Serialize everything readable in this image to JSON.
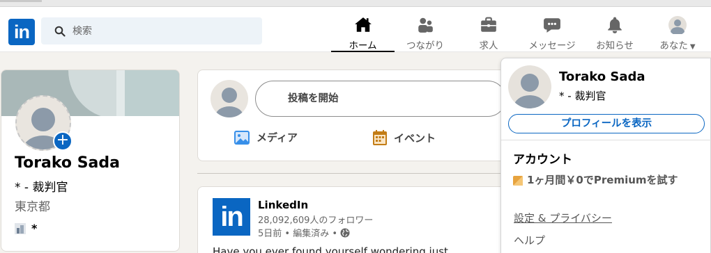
{
  "header": {
    "logo_text": "in",
    "search_placeholder": "検索",
    "nav": [
      {
        "label": "ホーム",
        "icon": "home-icon",
        "active": true
      },
      {
        "label": "つながり",
        "icon": "people-icon"
      },
      {
        "label": "求人",
        "icon": "briefcase-icon"
      },
      {
        "label": "メッセージ",
        "icon": "message-icon"
      },
      {
        "label": "お知らせ",
        "icon": "bell-icon"
      },
      {
        "label": "あなた",
        "icon": "me-avatar-icon"
      }
    ]
  },
  "profile": {
    "name": "Torako Sada",
    "title": "* - 裁判官",
    "location": "東京都",
    "company": "*"
  },
  "composer": {
    "placeholder": "投稿を開始",
    "actions": [
      {
        "label": "メディア",
        "icon": "image-icon"
      },
      {
        "label": "イベント",
        "icon": "calendar-icon"
      }
    ]
  },
  "feed": {
    "author": "LinkedIn",
    "logo_text": "in",
    "followers": "28,092,609人のフォロワー",
    "meta": "5日前 • 編集済み •",
    "text_partial": "Have you ever found yourself wondering just"
  },
  "dropdown": {
    "name": "Torako Sada",
    "title": "* - 裁判官",
    "view_profile": "プロフィールを表示",
    "section": "アカウント",
    "premium": "1ヶ月間￥0でPremiumを試す",
    "settings": "設定 & プライバシー",
    "help": "ヘルプ"
  },
  "colors": {
    "brand": "#0a66c2",
    "background": "#f4f2ee",
    "premium": "#e7a33e"
  }
}
